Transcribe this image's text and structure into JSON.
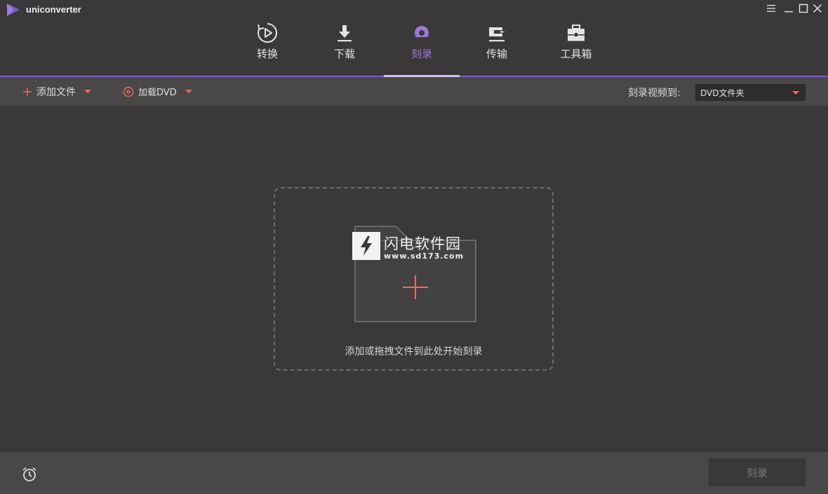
{
  "app": {
    "title": "uniconverter"
  },
  "window_controls": [
    {
      "name": "menu",
      "icon": "hamburger-menu-icon"
    },
    {
      "name": "minimize",
      "icon": "minimize-icon"
    },
    {
      "name": "maximize",
      "icon": "maximize-icon"
    },
    {
      "name": "close",
      "icon": "close-icon"
    }
  ],
  "nav": {
    "tabs": [
      {
        "label": "转换",
        "icon": "convert-play-icon",
        "active": false
      },
      {
        "label": "下载",
        "icon": "download-arrow-icon",
        "active": false
      },
      {
        "label": "刻录",
        "icon": "burn-disc-icon",
        "active": true
      },
      {
        "label": "传输",
        "icon": "transfer-device-icon",
        "active": false
      },
      {
        "label": "工具箱",
        "icon": "toolbox-icon",
        "active": false
      }
    ]
  },
  "toolbar": {
    "add_files_label": "添加文件",
    "load_dvd_label": "加载DVD",
    "burn_to_label": "刻录视频到:",
    "burn_target_value": "DVD文件夹"
  },
  "dropzone": {
    "hint": "添加或拖拽文件到此处开始刻录",
    "watermark_title": "闪电软件园",
    "watermark_url": "www.sd173.com"
  },
  "footer": {
    "burn_button_label": "刻录"
  },
  "colors": {
    "background": "#3b3839",
    "toolbar_bg": "#4a4748",
    "accent_purple": "#9a78d8",
    "accent_red": "#f06a5a",
    "disabled_text": "#7a7778"
  }
}
